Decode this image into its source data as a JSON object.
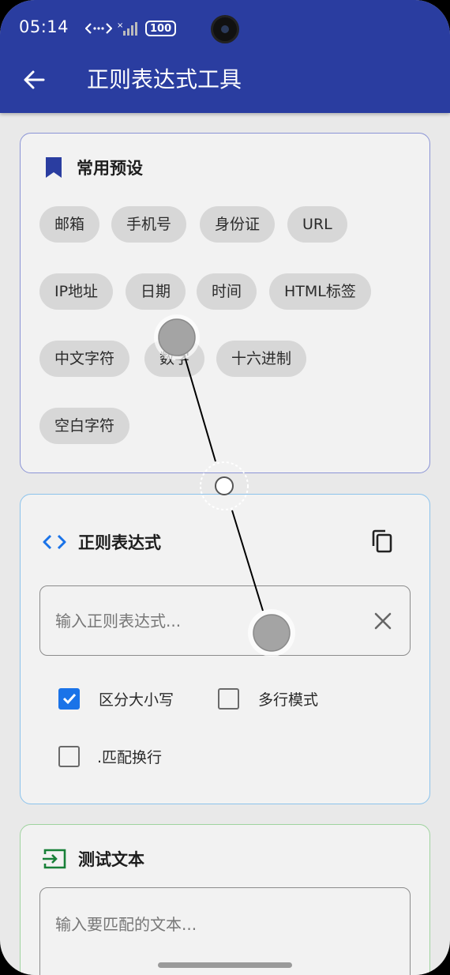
{
  "status_bar": {
    "time": "05:14",
    "signal_icon": "data-transfer-icon",
    "battery": "100"
  },
  "app_bar": {
    "title": "正则表达式工具",
    "back_icon": "arrow-back-icon"
  },
  "presets": {
    "title": "常用预设",
    "icon": "bookmark-icon",
    "accent": "#2a3da0",
    "chips": [
      "邮箱",
      "手机号",
      "身份证",
      "URL",
      "IP地址",
      "日期",
      "时间",
      "HTML标签",
      "中文字符",
      "数字",
      "十六进制",
      "空白字符"
    ]
  },
  "regex": {
    "title": "正则表达式",
    "icon": "code-icon",
    "accent": "#1a73e8",
    "placeholder": "输入正则表达式...",
    "options": [
      {
        "label": "区分大小写",
        "checked": true
      },
      {
        "label": "多行模式",
        "checked": false
      },
      {
        "label": ".匹配换行",
        "checked": false
      }
    ]
  },
  "test": {
    "title": "测试文本",
    "icon": "input-icon",
    "accent": "#188038",
    "placeholder": "输入要匹配的文本..."
  }
}
